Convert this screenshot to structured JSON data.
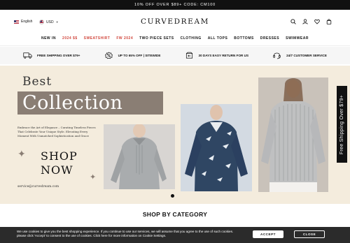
{
  "promo": {
    "text": "10% OFF OVER $89+ CODE: CM100"
  },
  "header": {
    "language": "English",
    "currency": "USD",
    "logo": "CURVEDREAM",
    "icons": [
      "search-icon",
      "user-icon",
      "heart-icon",
      "bag-icon"
    ]
  },
  "nav": {
    "items": [
      {
        "label": "NEW IN",
        "hot": false
      },
      {
        "label": "2024 $$",
        "hot": true
      },
      {
        "label": "SWEATSHIRT",
        "hot": true
      },
      {
        "label": "FW 2024",
        "hot": true
      },
      {
        "label": "TWO PIECE SETS",
        "hot": false
      },
      {
        "label": "CLOTHING",
        "hot": false
      },
      {
        "label": "ALL TOPS",
        "hot": false
      },
      {
        "label": "BOTTOMS",
        "hot": false
      },
      {
        "label": "DRESSES",
        "hot": false
      },
      {
        "label": "SWIMWEAR",
        "hot": false
      }
    ],
    "hot_color": "#d0443a"
  },
  "benefits": [
    {
      "icon": "truck-icon",
      "text": "FREE SHIPPING OVER $79+"
    },
    {
      "icon": "discount-icon",
      "text": "UP TO 65% OFF | SITEWIDE"
    },
    {
      "icon": "return-icon",
      "text": "30 DAYS EASY RETURN FOR US"
    },
    {
      "icon": "headset-icon",
      "text": "24/7 CUSTOMER SERVICE"
    }
  ],
  "hero": {
    "title_line1": "Best",
    "title_line2": "Collection",
    "description": "Embrace the Art of Elegance – Curating Timeless Pieces That Celebrate Your Unique Style. Elevating Every Moment With Unmatched Sophistication and Grace",
    "cta_line1": "SHOP",
    "cta_line2": "NOW",
    "email": "service@curvedream.com",
    "accent_color": "#8a7e74",
    "background": "#f4ecdd"
  },
  "side_tab": {
    "text": "Free Shipping Over $79+"
  },
  "category": {
    "title": "SHOP BY CATEGORY"
  },
  "cookie": {
    "text": "We use cookies to give you the best shopping experience. If you continue to use our services, we will assume that you agree to the use of such cookies. please click 'Accept' to consent to the use of cookies. Click here for more information on Cookie Settings.",
    "accept_label": "ACCEPT",
    "close_label": "CLOSE"
  }
}
